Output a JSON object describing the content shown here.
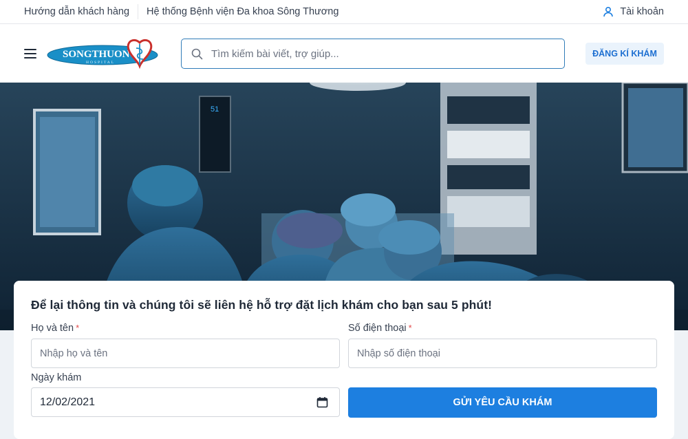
{
  "topbar": {
    "guide_link": "Hướng dẫn khách hàng",
    "hospital_system_link": "Hệ thống Bệnh viện Đa khoa Sông Thương",
    "account_label": "Tài khoản"
  },
  "header": {
    "logo_text": "SONGTHUONG",
    "logo_subtext": "HOSPITAL",
    "search_placeholder": "Tìm kiếm bài viết, trợ giúp...",
    "register_button": "ĐĂNG KÍ KHÁM"
  },
  "hero": {
    "monitor_number": "51"
  },
  "form": {
    "title": "Để lại thông tin và chúng tôi sẽ liên hệ hỗ trợ đặt lịch khám cho bạn sau 5 phút!",
    "name_label": "Họ và tên",
    "name_placeholder": "Nhập họ và tên",
    "phone_label": "Số điện thoại",
    "phone_placeholder": "Nhập số điện thoại",
    "required_mark": "*",
    "date_label": "Ngày khám",
    "date_value": "12/02/2021",
    "submit_button": "GỬI YÊU CẦU KHÁM"
  },
  "colors": {
    "primary": "#1d7fe0",
    "search_border": "#2f7bb8",
    "logo_blue": "#1a8fc7",
    "logo_red": "#c9302c",
    "required": "#e24b4b"
  },
  "icons": {
    "account": "user-icon",
    "search": "search-icon",
    "menu": "hamburger-icon",
    "date": "calendar-icon"
  }
}
